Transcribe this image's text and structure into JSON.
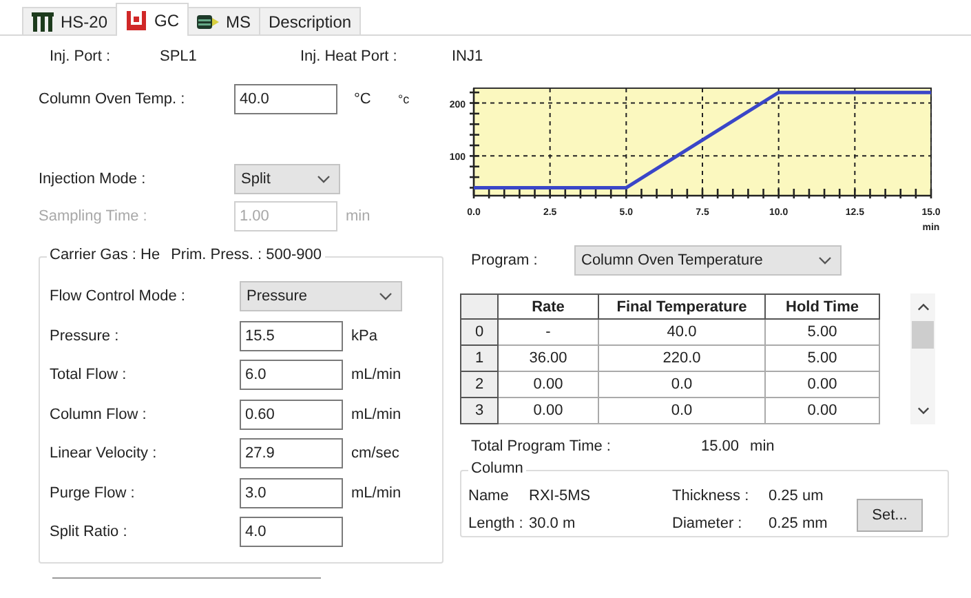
{
  "tabs": [
    {
      "label": "HS-20",
      "kind": "vials",
      "selected": false
    },
    {
      "label": "GC",
      "kind": "oven",
      "selected": true
    },
    {
      "label": "MS",
      "kind": "detector",
      "selected": false
    },
    {
      "label": "Description",
      "selected": false
    }
  ],
  "ports": [
    {
      "label": "Inj. Port :",
      "value": "SPL1"
    },
    {
      "label": "Inj. Heat Port :",
      "value": "INJ1"
    }
  ],
  "oven_temp": {
    "label": "Column Oven Temp. :",
    "value": "40.0",
    "unit": "°C",
    "unit_2": "°c"
  },
  "injection_mode": {
    "label": "Injection Mode :",
    "value": "Split"
  },
  "sampling_time": {
    "label": "Sampling Time :",
    "value": "1.00",
    "unit": "min",
    "disabled": true
  },
  "carrier_gas": {
    "title": "Carrier Gas : He",
    "prim_press": "Prim. Press. : 500-900",
    "rows": [
      {
        "kind": "dropdown",
        "label": "Flow Control Mode :",
        "value": "Pressure"
      },
      {
        "kind": "field",
        "label": "Pressure :",
        "value": "15.5",
        "unit": "kPa"
      },
      {
        "kind": "field",
        "label": "Total Flow :",
        "value": "6.0",
        "unit": "mL/min"
      },
      {
        "kind": "field",
        "label": "Column Flow :",
        "value": "0.60",
        "unit": "mL/min"
      },
      {
        "kind": "field",
        "label": "Linear Velocity :",
        "value": "27.9",
        "unit": "cm/sec"
      },
      {
        "kind": "field",
        "label": "Purge Flow :",
        "value": "3.0",
        "unit": "mL/min"
      },
      {
        "kind": "field",
        "label": "Split Ratio :",
        "value": "4.0"
      }
    ]
  },
  "chart_data": {
    "type": "line",
    "xlabel": "min",
    "x": [
      0,
      5,
      10,
      15
    ],
    "series": [
      {
        "color": "#3a46c8",
        "values": [
          40,
          40,
          220,
          220
        ]
      }
    ],
    "grid": true,
    "xlim": [
      0,
      15
    ],
    "ylim": [
      25,
      228
    ],
    "xticks": [
      {
        "value": 0,
        "label": "0.0"
      },
      {
        "value": 2.5,
        "label": "2.5"
      },
      {
        "value": 5,
        "label": "5.0"
      },
      {
        "value": 7.5,
        "label": "7.5"
      },
      {
        "value": 10,
        "label": "10.0"
      },
      {
        "value": 12.5,
        "label": "12.5"
      },
      {
        "value": 15,
        "label": "15.0"
      }
    ],
    "yticks": [
      100,
      200
    ]
  },
  "program": {
    "label": "Program :",
    "value": "Column Oven Temperature"
  },
  "table": {
    "columns": [
      "Rate",
      "Final Temperature",
      "Hold Time"
    ],
    "rows": [
      {
        "index": "0",
        "cells": [
          "-",
          "40.0",
          "5.00"
        ]
      },
      {
        "index": "1",
        "cells": [
          "36.00",
          "220.0",
          "5.00"
        ]
      },
      {
        "index": "2",
        "cells": [
          "0.00",
          "0.0",
          "0.00"
        ]
      },
      {
        "index": "3",
        "cells": [
          "0.00",
          "0.0",
          "0.00"
        ]
      }
    ]
  },
  "total_time": {
    "label": "Total Program Time :",
    "value": "15.00",
    "unit": "min"
  },
  "column": {
    "title": "Column",
    "name_label": "Name",
    "name": "RXI-5MS",
    "length_label": "Length :",
    "length": "30.0 m",
    "thickness_label": "Thickness :",
    "thickness": "0.25 um",
    "diameter_label": "Diameter :",
    "diameter": "0.25 mm",
    "button": "Set..."
  }
}
